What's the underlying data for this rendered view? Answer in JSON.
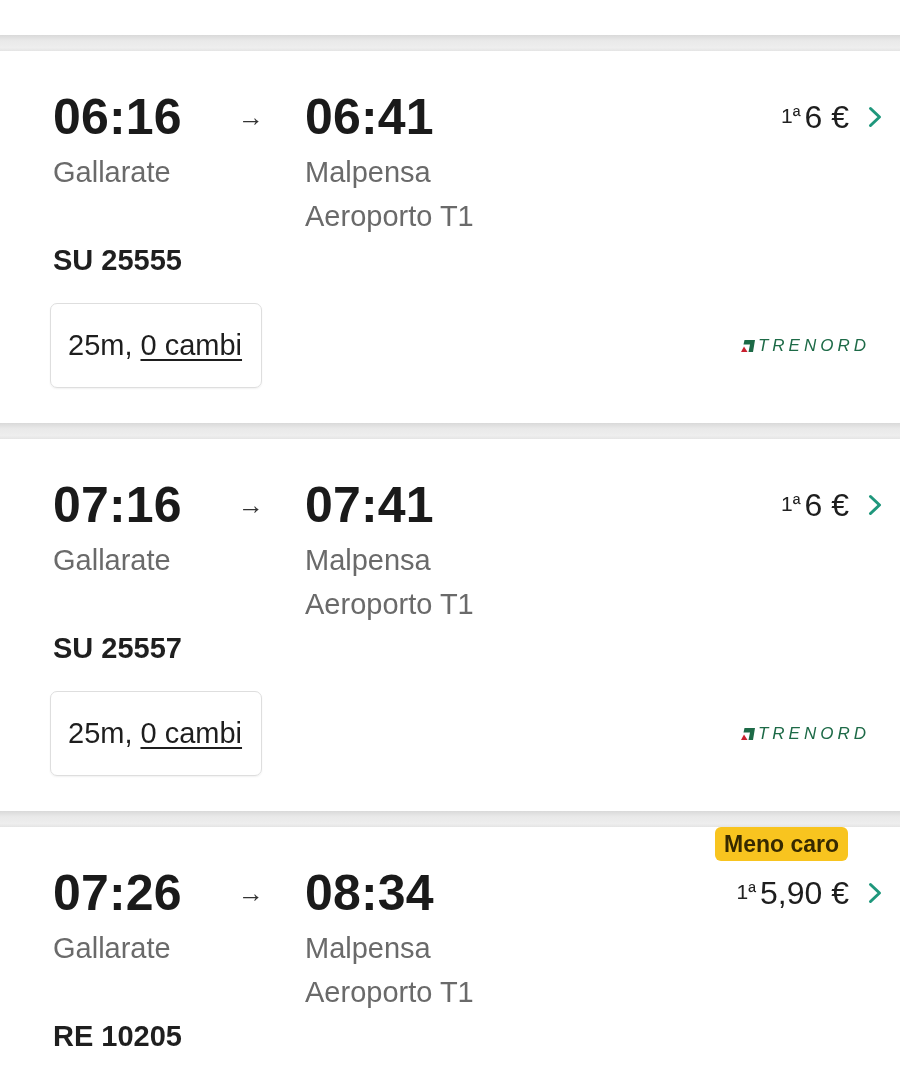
{
  "trips": [
    {
      "departure_time": "06:16",
      "arrow": "→",
      "arrival_time": "06:41",
      "departure_station": "Gallarate",
      "arrival_station": "Malpensa Aeroporto T1",
      "train_number": "SU 25555",
      "class_label": "1ª",
      "price": "6 €",
      "duration": "25m,",
      "changes": "0 cambi",
      "operator": "TRENORD"
    },
    {
      "departure_time": "07:16",
      "arrow": "→",
      "arrival_time": "07:41",
      "departure_station": "Gallarate",
      "arrival_station": "Malpensa Aeroporto T1",
      "train_number": "SU 25557",
      "class_label": "1ª",
      "price": "6 €",
      "duration": "25m,",
      "changes": "0 cambi",
      "operator": "TRENORD"
    },
    {
      "badge": "Meno caro",
      "departure_time": "07:26",
      "arrow": "→",
      "arrival_time": "08:34",
      "departure_station": "Gallarate",
      "arrival_station": "Malpensa Aeroporto T1",
      "train_number": "RE 10205",
      "class_label": "1ª",
      "price": "5,90 €"
    }
  ]
}
